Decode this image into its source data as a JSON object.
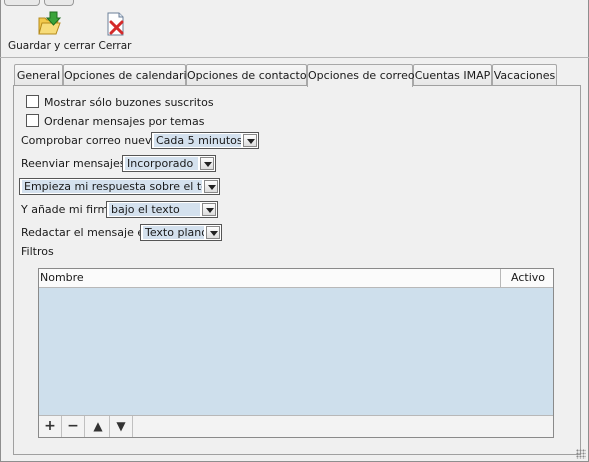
{
  "toolbar": {
    "save_close_label": "Guardar y cerrar",
    "close_label": "Cerrar"
  },
  "tabs": [
    {
      "label": "General"
    },
    {
      "label": "Opciones de calendario"
    },
    {
      "label": "Opciones de contactos"
    },
    {
      "label": "Opciones de correo",
      "active": true
    },
    {
      "label": "Cuentas IMAP"
    },
    {
      "label": "Vacaciones"
    }
  ],
  "mail": {
    "show_subscribed_label": "Mostrar sólo buzones suscritos",
    "show_subscribed_checked": false,
    "sort_threads_label": "Ordenar mensajes por temas",
    "sort_threads_checked": false,
    "check_mail_label": "Comprobar correo nuevo:",
    "check_mail_value": "Cada 5 minutos",
    "forward_label": "Reenviar mensajes:",
    "forward_value": "Incorporado",
    "reply_value": "Empieza mi respuesta sobre el texto",
    "signature_label": "Y añade mi firma",
    "signature_value": "bajo el texto",
    "compose_label": "Redactar el mensaje en",
    "compose_value": "Texto plano",
    "filters_label": "Filtros"
  },
  "filters_table": {
    "columns": [
      "Nombre",
      "Activo"
    ],
    "rows": [],
    "buttons": [
      "+",
      "−",
      "▲",
      "▼"
    ]
  },
  "colors": {
    "background": "#f0f0f0",
    "selection": "#cedfec",
    "select_value_bg": "#d4e1ee"
  }
}
